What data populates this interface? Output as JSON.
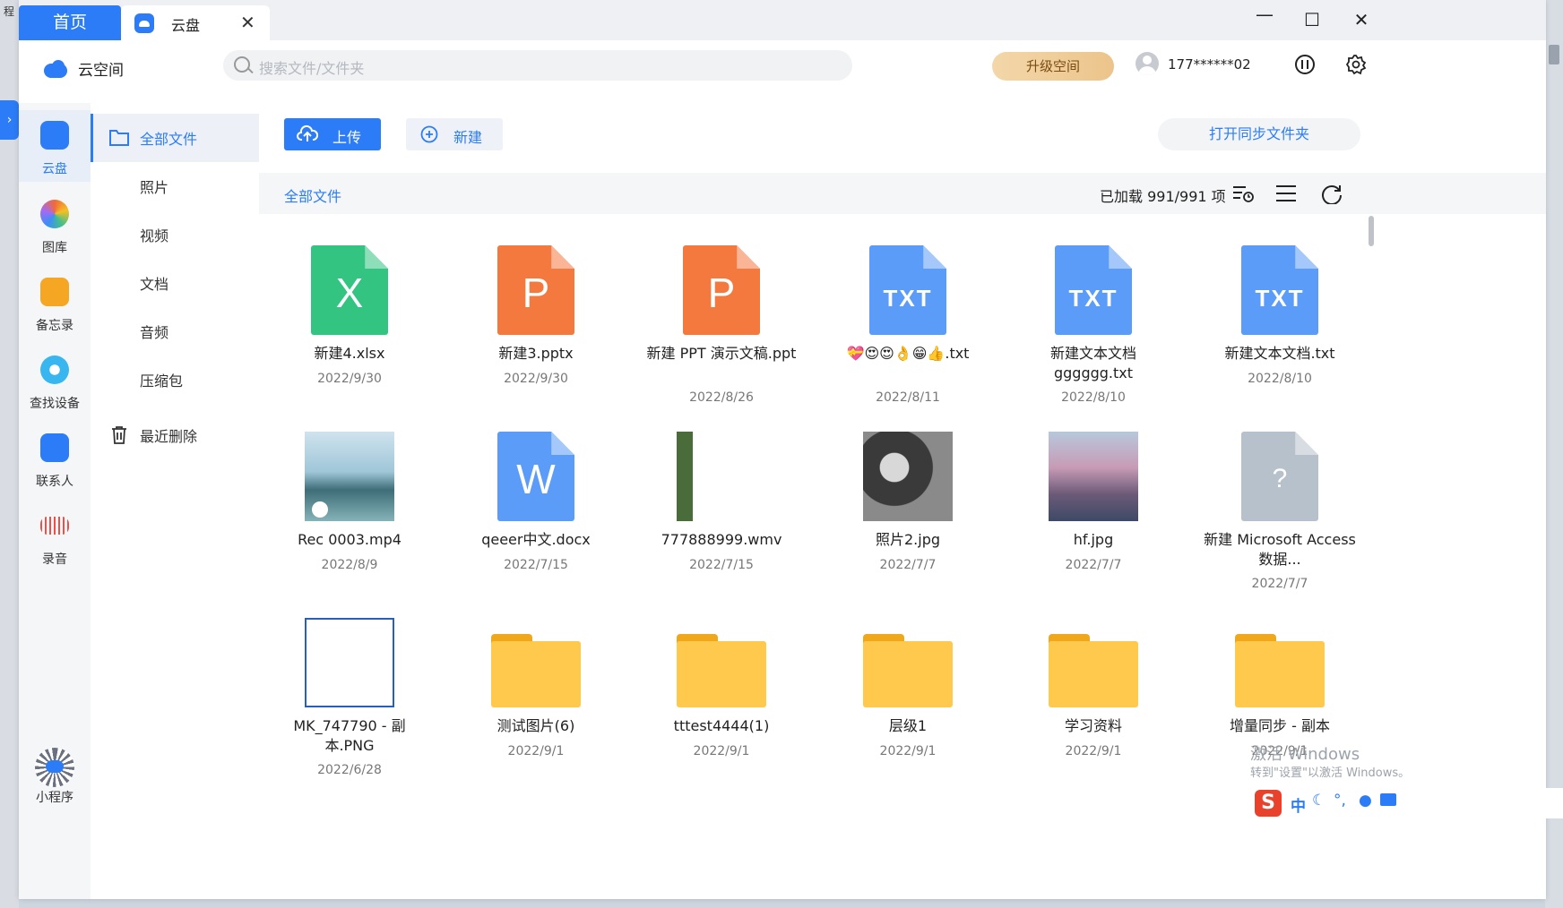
{
  "tabs": {
    "home": "首页",
    "cloud": "云盘"
  },
  "brand": "云空间",
  "search": {
    "placeholder": "搜索文件/文件夹"
  },
  "header": {
    "upgrade": "升级空间",
    "phone": "177******02"
  },
  "nav": [
    {
      "label": "云盘",
      "icon": "cloud-icon",
      "color": "#2b7cf6"
    },
    {
      "label": "图库",
      "icon": "gallery-icon",
      "color": "#f06a3a"
    },
    {
      "label": "备忘录",
      "icon": "notes-icon",
      "color": "#f5a623"
    },
    {
      "label": "查找设备",
      "icon": "find-device-icon",
      "color": "#38b6f0"
    },
    {
      "label": "联系人",
      "icon": "contacts-icon",
      "color": "#2b7cf6"
    },
    {
      "label": "录音",
      "icon": "recorder-icon",
      "color": "#e5534b"
    }
  ],
  "miniprogram": "小程序",
  "categories": {
    "all": "全部文件",
    "photos": "照片",
    "videos": "视频",
    "docs": "文档",
    "audio": "音频",
    "archives": "压缩包",
    "deleted": "最近删除"
  },
  "actions": {
    "upload": "上传",
    "new": "新建",
    "sync": "打开同步文件夹"
  },
  "toolbar": {
    "breadcrumb": "全部文件",
    "loaded": "已加载 991/991 项"
  },
  "files": [
    {
      "name": "新建4.xlsx",
      "date": "2022/9/30",
      "kind": "xlsx"
    },
    {
      "name": "新建3.pptx",
      "date": "2022/9/30",
      "kind": "ppt"
    },
    {
      "name": "新建 PPT 演示文稿.ppt",
      "date": "2022/8/26",
      "kind": "ppt"
    },
    {
      "name": "💝😍😍👌😁👍.txt",
      "date": "2022/8/11",
      "kind": "txt"
    },
    {
      "name": "新建文本文档gggggg.txt",
      "date": "2022/8/10",
      "kind": "txt"
    },
    {
      "name": "新建文本文档.txt",
      "date": "2022/8/10",
      "kind": "txt"
    },
    {
      "name": "Rec 0003.mp4",
      "date": "2022/8/9",
      "kind": "video"
    },
    {
      "name": "qeeer中文.docx",
      "date": "2022/7/15",
      "kind": "docx"
    },
    {
      "name": "777888999.wmv",
      "date": "2022/7/15",
      "kind": "wmv"
    },
    {
      "name": "照片2.jpg",
      "date": "2022/7/7",
      "kind": "photo-bw"
    },
    {
      "name": "hf.jpg",
      "date": "2022/7/7",
      "kind": "photo-city"
    },
    {
      "name": "新建 Microsoft Access 数据...",
      "date": "2022/7/7",
      "kind": "unknown"
    },
    {
      "name": "MK_747790 - 副本.PNG",
      "date": "2022/6/28",
      "kind": "png"
    },
    {
      "name": "测试图片(6)",
      "date": "2022/9/1",
      "kind": "folder"
    },
    {
      "name": "tttest4444(1)",
      "date": "2022/9/1",
      "kind": "folder"
    },
    {
      "name": "层级1",
      "date": "2022/9/1",
      "kind": "folder"
    },
    {
      "name": "学习资料",
      "date": "2022/9/1",
      "kind": "folder"
    },
    {
      "name": "增量同步 - 副本",
      "date": "2022/9/1",
      "kind": "folder"
    }
  ],
  "colors": {
    "accent": "#2b7cf6",
    "xlsx": "#33c481",
    "ppt": "#f4793f",
    "txt": "#5b9cf8",
    "docx": "#5b9cf8",
    "unknown": "#b7c1cc",
    "folder": "#ffc94d"
  },
  "watermark": {
    "line1": "激活 Windows",
    "line2": "转到\"设置\"以激活 Windows。"
  },
  "ime": {
    "lang": "中"
  }
}
